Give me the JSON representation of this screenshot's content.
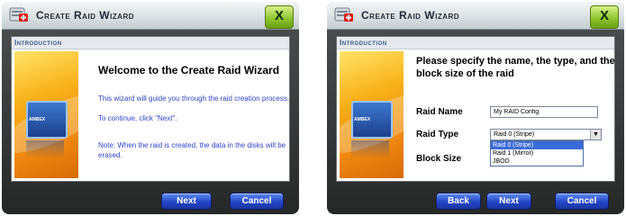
{
  "colors": {
    "frame": "#2f3233",
    "content_bg": "#ffffff",
    "header_text": "#34568a",
    "body_blue": "#2f44c8",
    "button_blue": "#2346c8",
    "close_green": "#8cc22a"
  },
  "icons": {
    "app": "raid-wizard-icon",
    "close": "close-icon",
    "chip": "chip-icon",
    "dropdown": "chevron-down-icon"
  },
  "dialog1": {
    "title": "Create Raid Wizard",
    "close_label": "X",
    "section": "Introduction",
    "art_label": "AMBEX",
    "heading": "Welcome to the Create Raid Wizard",
    "body": "This wizard will guide you through the raid creation process.",
    "continue": "To continue, click \"Next\".",
    "note": "Note: When the raid is created, the data in the disks will be erased.",
    "buttons": {
      "next": "Next",
      "cancel": "Cancel"
    }
  },
  "dialog2": {
    "title": "Create Raid Wizard",
    "close_label": "X",
    "section": "Introduction",
    "art_label": "AMBEX",
    "prompt": "Please specify the name, the type, and the block size of the raid",
    "name_label": "Raid Name",
    "name_value": "My RAID Config",
    "type_label": "Raid Type",
    "type_selected": "Raid 0 (Stripe)",
    "type_options": [
      "Raid 0 (Stripe)",
      "Raid 1 (Mirror)",
      "JBOD"
    ],
    "block_label": "Block Size",
    "buttons": {
      "back": "Back",
      "next": "Next",
      "cancel": "Cancel"
    }
  }
}
